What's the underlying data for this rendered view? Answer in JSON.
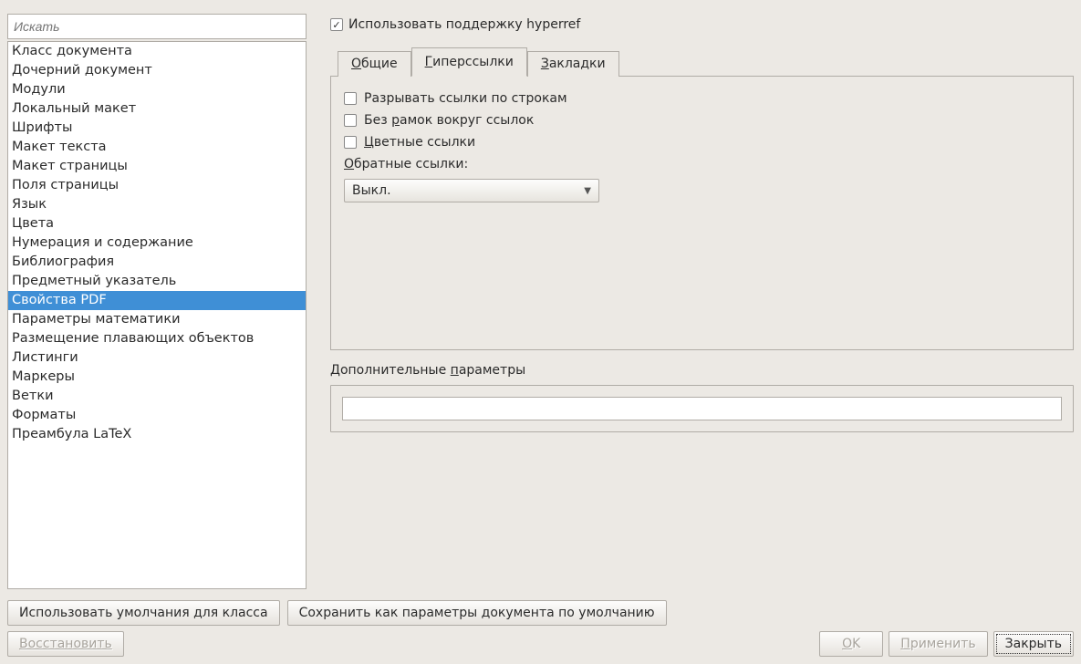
{
  "search": {
    "placeholder": "Искать"
  },
  "sidebar": {
    "items": [
      "Класс документа",
      "Дочерний документ",
      "Модули",
      "Локальный макет",
      "Шрифты",
      "Макет текста",
      "Макет страницы",
      "Поля страницы",
      "Язык",
      "Цвета",
      "Нумерация и содержание",
      "Библиография",
      "Предметный указатель",
      "Свойства PDF",
      "Параметры математики",
      "Размещение плавающих объектов",
      "Листинги",
      "Маркеры",
      "Ветки",
      "Форматы",
      "Преамбула LaTeX"
    ],
    "selected_index": 13
  },
  "top_checkbox": {
    "label": "Использовать поддержку hyperref",
    "checked": true
  },
  "tabs": {
    "items": [
      {
        "pre": "",
        "u": "О",
        "post": "бщие"
      },
      {
        "pre": "",
        "u": "Г",
        "post": "иперссылки"
      },
      {
        "pre": "",
        "u": "З",
        "post": "акладки"
      }
    ],
    "active_index": 1
  },
  "panel": {
    "chk1": {
      "label": "Разрывать ссылки по строкам",
      "checked": false
    },
    "chk2": {
      "pre": "Без ",
      "u": "р",
      "post": "амок вокруг ссылок",
      "checked": false
    },
    "chk3": {
      "pre": "",
      "u": "Ц",
      "post": "ветные ссылки",
      "checked": false
    },
    "backlinks": {
      "pre": "",
      "u": "О",
      "post": "братные ссылки:",
      "value": "Выкл."
    }
  },
  "addparams": {
    "pre": "Дополнительные ",
    "u": "п",
    "post": "араметры",
    "value": ""
  },
  "buttons": {
    "use_defaults": "Использовать умолчания для класса",
    "save_defaults": "Сохранить как параметры документа по умолчанию",
    "restore": "Восстановить",
    "ok": {
      "pre": "",
      "u": "O",
      "post": "K"
    },
    "apply": {
      "pre": "",
      "u": "П",
      "post": "рименить"
    },
    "close": "Закрыть"
  }
}
